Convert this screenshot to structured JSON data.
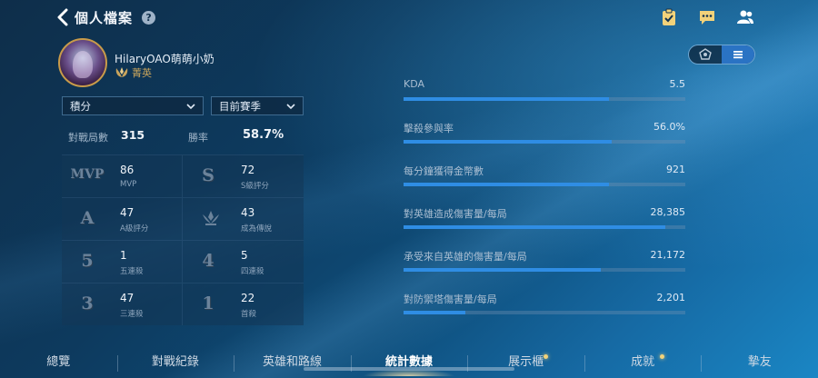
{
  "header": {
    "back_icon": "chevron-left-icon",
    "title": "個人檔案",
    "help_label": "?"
  },
  "top_icons": [
    "clipboard-icon",
    "chat-icon",
    "friends-icon"
  ],
  "profile": {
    "player_name": "HilaryOAO萌萌小奶",
    "rank_icon": "laurel-rank-icon",
    "rank_label": "菁英"
  },
  "filters": {
    "mode": "積分",
    "season": "目前賽季"
  },
  "summary": {
    "matches_label": "對戰局數",
    "matches_value": "315",
    "winrate_label": "勝率",
    "winrate_value": "58.7%"
  },
  "grid": [
    {
      "icon_text": "MVP",
      "value": "86",
      "label": "MVP"
    },
    {
      "icon_text": "S",
      "value": "72",
      "label": "S級評分"
    },
    {
      "icon_text": "A",
      "value": "47",
      "label": "A級評分"
    },
    {
      "icon_text": "",
      "value": "43",
      "label": "成為傳說"
    },
    {
      "icon_text": "5",
      "value": "1",
      "label": "五連殺"
    },
    {
      "icon_text": "4",
      "value": "5",
      "label": "四連殺"
    },
    {
      "icon_text": "3",
      "value": "47",
      "label": "三連殺"
    },
    {
      "icon_text": "1",
      "value": "22",
      "label": "首殺"
    }
  ],
  "stats": [
    {
      "label": "KDA",
      "value": "5.5",
      "fill_pct": 73
    },
    {
      "label": "擊殺參與率",
      "value": "56.0%",
      "fill_pct": 74
    },
    {
      "label": "每分鐘獲得金幣數",
      "value": "921",
      "fill_pct": 73
    },
    {
      "label": "對英雄造成傷害量/每局",
      "value": "28,385",
      "fill_pct": 93
    },
    {
      "label": "承受來自英雄的傷害量/每局",
      "value": "21,172",
      "fill_pct": 70
    },
    {
      "label": "對防禦塔傷害量/每局",
      "value": "2,201",
      "fill_pct": 22
    }
  ],
  "view_toggle": {
    "options": [
      "radar-view-icon",
      "list-view-icon"
    ],
    "selected": "list-view-icon"
  },
  "nav": [
    {
      "label": "總覽",
      "active": false,
      "dot": false
    },
    {
      "label": "對戰紀錄",
      "active": false,
      "dot": false
    },
    {
      "label": "英雄和路線",
      "active": false,
      "dot": false
    },
    {
      "label": "統計數據",
      "active": true,
      "dot": false
    },
    {
      "label": "展示櫃",
      "active": false,
      "dot": true
    },
    {
      "label": "成就",
      "active": false,
      "dot": true
    },
    {
      "label": "摯友",
      "active": false,
      "dot": false
    }
  ],
  "colors": {
    "accent_bar": "#2f8de4",
    "rank_gold": "#c9a45c",
    "toggle_active": "#2a73c4"
  }
}
